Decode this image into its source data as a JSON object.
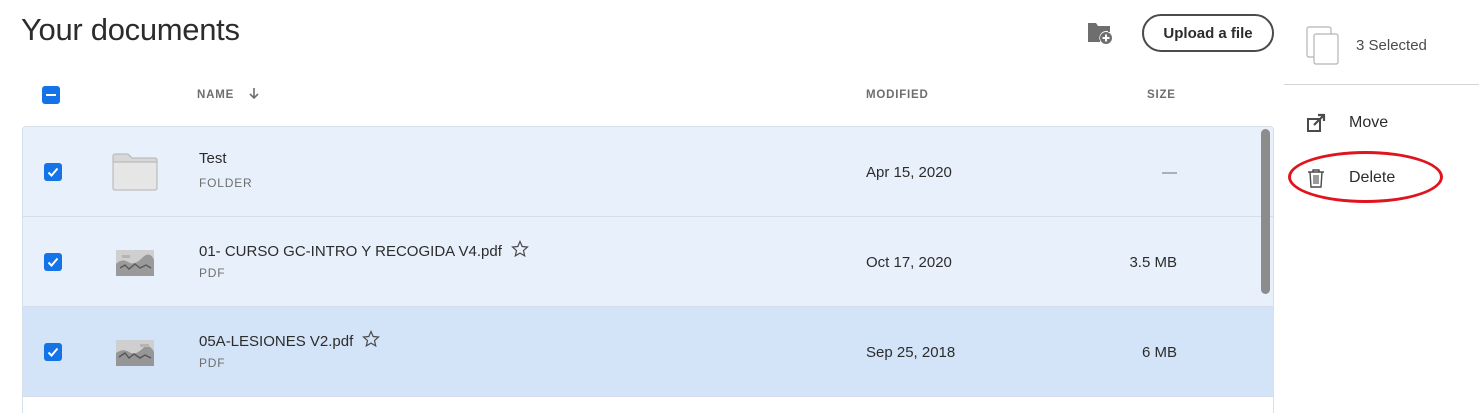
{
  "page": {
    "title": "Your documents",
    "upload_label": "Upload a file"
  },
  "columns": {
    "name": "NAME",
    "modified": "MODIFIED",
    "size": "SIZE"
  },
  "rows": [
    {
      "name": "Test",
      "type": "FOLDER",
      "modified": "Apr 15, 2020",
      "size": "—",
      "icon": "folder-icon",
      "selected": true,
      "starrable": false
    },
    {
      "name": "01- CURSO GC-INTRO Y RECOGIDA V4.pdf",
      "type": "PDF",
      "modified": "Oct 17, 2020",
      "size": "3.5 MB",
      "icon": "pdf-thumbnail",
      "selected": true,
      "starrable": true
    },
    {
      "name": "05A-LESIONES V2.pdf",
      "type": "PDF",
      "modified": "Sep 25, 2018",
      "size": "6 MB",
      "icon": "pdf-thumbnail",
      "selected": true,
      "starrable": true
    }
  ],
  "sidebar": {
    "selected_count_label": "3 Selected",
    "actions": [
      {
        "label": "Move",
        "icon": "move-icon"
      },
      {
        "label": "Delete",
        "icon": "trash-icon"
      }
    ]
  },
  "colors": {
    "accent": "#1473e6",
    "row_selected": "#e8f1fb",
    "row_highlight": "#d3e3f8",
    "annotation": "#e0141e"
  }
}
